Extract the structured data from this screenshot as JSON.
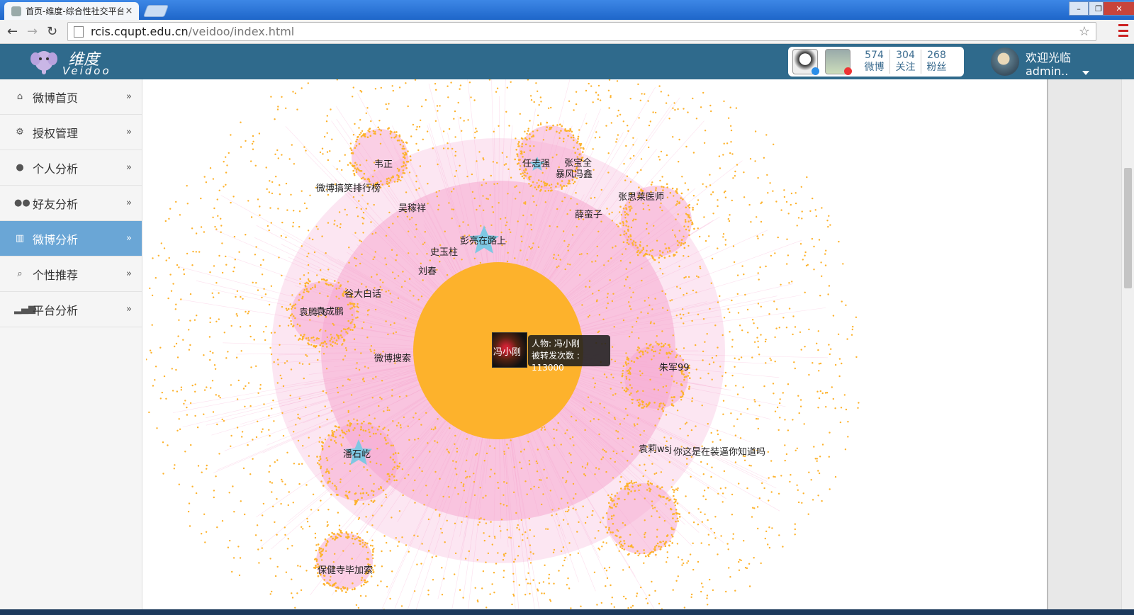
{
  "browser": {
    "tab_title": "首页-维度-综合性社交平台",
    "tab_close": "×",
    "url_host": "rcis.cqupt.edu.cn",
    "url_path": "/veidoo/index.html",
    "back": "←",
    "forward": "→",
    "reload": "↻",
    "bookmark": "☆",
    "win_min": "–",
    "win_max": "❐",
    "win_close": "✕"
  },
  "header": {
    "logo_cn": "维度",
    "logo_en": "Veidoo",
    "stats": [
      {
        "value": "574",
        "label": "微博"
      },
      {
        "value": "304",
        "label": "关注"
      },
      {
        "value": "268",
        "label": "粉丝"
      }
    ],
    "welcome": "欢迎光临",
    "username": "admin.."
  },
  "sidebar": {
    "items": [
      {
        "label": "微博首页",
        "icon": "home-icon",
        "glyph": "⌂",
        "arrow": "»"
      },
      {
        "label": "授权管理",
        "icon": "gears-icon",
        "glyph": "⚙",
        "arrow": "»"
      },
      {
        "label": "个人分析",
        "icon": "user-icon",
        "glyph": "●",
        "arrow": "»"
      },
      {
        "label": "好友分析",
        "icon": "users-icon",
        "glyph": "●●",
        "arrow": "»"
      },
      {
        "label": "微博分析",
        "icon": "bar-chart-icon",
        "glyph": "▥",
        "arrow": "»"
      },
      {
        "label": "个性推荐",
        "icon": "search-icon",
        "glyph": "⌕",
        "arrow": "»"
      },
      {
        "label": "平台分析",
        "icon": "signal-icon",
        "glyph": "▂▄▆",
        "arrow": "»"
      }
    ],
    "active_index": 4
  },
  "graph": {
    "colors": {
      "node": "#fdb22c",
      "edge": "#f6a7cf",
      "star": "#7ec8e3"
    },
    "focus": {
      "name": "冯小刚"
    },
    "tooltip": {
      "line1": "人物: 冯小刚",
      "line2": "被转发次数 : 113000"
    },
    "labels": [
      "韦正",
      "任志强",
      "张宝全",
      "暴风冯鑫",
      "微博搞笑排行榜",
      "吴稼祥",
      "张思莱医师",
      "薛蛮子",
      "彭亮在路上",
      "史玉柱",
      "刘春",
      "谷大白话",
      "袁腾飞",
      "袁成鹏",
      "微博搜索",
      "朱军99",
      "潘石屹",
      "袁莉wsj",
      "你这是在装逼你知道吗",
      "保健寺毕加索"
    ]
  }
}
